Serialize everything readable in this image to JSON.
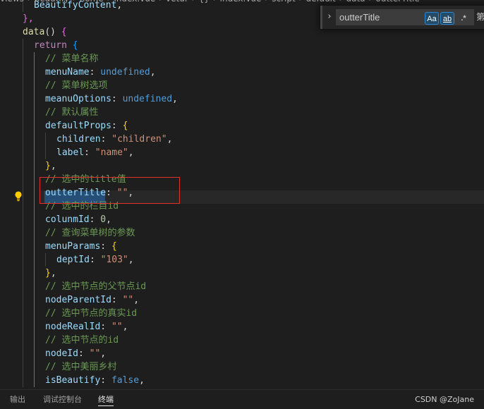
{
  "breadcrumb": {
    "items": [
      "views",
      "beautify",
      "home",
      "index.vue",
      "vetur",
      "{}",
      "index.vue",
      "script",
      "default",
      "data",
      "outterTitle"
    ]
  },
  "editor": {
    "lines": [
      [
        {
          "t": "BeautifyContent",
          "c": "prop"
        },
        {
          "t": ",",
          "c": "punc"
        }
      ],
      [
        {
          "t": "},",
          "c": "brace2"
        }
      ],
      [
        {
          "t": "data",
          "c": "func"
        },
        {
          "t": "() ",
          "c": "punc"
        },
        {
          "t": "{",
          "c": "brace2"
        }
      ],
      [
        {
          "t": "return",
          "c": "kw"
        },
        {
          "t": " ",
          "c": "punc"
        },
        {
          "t": "{",
          "c": "brace3"
        }
      ],
      [
        {
          "t": "// 菜单名称",
          "c": "comment"
        }
      ],
      [
        {
          "t": "menuName",
          "c": "prop"
        },
        {
          "t": ": ",
          "c": "punc"
        },
        {
          "t": "undefined",
          "c": "const"
        },
        {
          "t": ",",
          "c": "punc"
        }
      ],
      [
        {
          "t": "// 菜单树选项",
          "c": "comment"
        }
      ],
      [
        {
          "t": "meanuOptions",
          "c": "prop"
        },
        {
          "t": ": ",
          "c": "punc"
        },
        {
          "t": "undefined",
          "c": "const"
        },
        {
          "t": ",",
          "c": "punc"
        }
      ],
      [
        {
          "t": "// 默认属性",
          "c": "comment"
        }
      ],
      [
        {
          "t": "defaultProps",
          "c": "prop"
        },
        {
          "t": ": ",
          "c": "punc"
        },
        {
          "t": "{",
          "c": "brace1"
        }
      ],
      [
        {
          "t": "children",
          "c": "prop"
        },
        {
          "t": ": ",
          "c": "punc"
        },
        {
          "t": "\"children\"",
          "c": "str"
        },
        {
          "t": ",",
          "c": "punc"
        }
      ],
      [
        {
          "t": "label",
          "c": "prop"
        },
        {
          "t": ": ",
          "c": "punc"
        },
        {
          "t": "\"name\"",
          "c": "str"
        },
        {
          "t": ",",
          "c": "punc"
        }
      ],
      [
        {
          "t": "}",
          "c": "brace1"
        },
        {
          "t": ",",
          "c": "punc"
        }
      ],
      [
        {
          "t": "// 选中的title值",
          "c": "comment"
        }
      ],
      [
        {
          "t": "outterTitle",
          "c": "prop"
        },
        {
          "t": ": ",
          "c": "punc"
        },
        {
          "t": "\"\"",
          "c": "str"
        },
        {
          "t": ",",
          "c": "punc"
        }
      ],
      [
        {
          "t": "// 选中的栏目id",
          "c": "comment"
        }
      ],
      [
        {
          "t": "colunmId",
          "c": "prop"
        },
        {
          "t": ": ",
          "c": "punc"
        },
        {
          "t": "0",
          "c": "num"
        },
        {
          "t": ",",
          "c": "punc"
        }
      ],
      [
        {
          "t": "// 查询菜单树的参数",
          "c": "comment"
        }
      ],
      [
        {
          "t": "menuParams",
          "c": "prop"
        },
        {
          "t": ": ",
          "c": "punc"
        },
        {
          "t": "{",
          "c": "brace1"
        }
      ],
      [
        {
          "t": "deptId",
          "c": "prop"
        },
        {
          "t": ": ",
          "c": "punc"
        },
        {
          "t": "\"103\"",
          "c": "str"
        },
        {
          "t": ",",
          "c": "punc"
        }
      ],
      [
        {
          "t": "}",
          "c": "brace1"
        },
        {
          "t": ",",
          "c": "punc"
        }
      ],
      [
        {
          "t": "// 选中节点的父节点id",
          "c": "comment"
        }
      ],
      [
        {
          "t": "nodeParentId",
          "c": "prop"
        },
        {
          "t": ": ",
          "c": "punc"
        },
        {
          "t": "\"\"",
          "c": "str"
        },
        {
          "t": ",",
          "c": "punc"
        }
      ],
      [
        {
          "t": "// 选中节点的真实id",
          "c": "comment"
        }
      ],
      [
        {
          "t": "nodeRealId",
          "c": "prop"
        },
        {
          "t": ": ",
          "c": "punc"
        },
        {
          "t": "\"\"",
          "c": "str"
        },
        {
          "t": ",",
          "c": "punc"
        }
      ],
      [
        {
          "t": "// 选中节点的id",
          "c": "comment"
        }
      ],
      [
        {
          "t": "nodeId",
          "c": "prop"
        },
        {
          "t": ": ",
          "c": "punc"
        },
        {
          "t": "\"\"",
          "c": "str"
        },
        {
          "t": ",",
          "c": "punc"
        }
      ],
      [
        {
          "t": "// 选中美丽乡村",
          "c": "comment"
        }
      ],
      [
        {
          "t": "isBeautify",
          "c": "prop"
        },
        {
          "t": ": ",
          "c": "punc"
        },
        {
          "t": "false",
          "c": "const"
        },
        {
          "t": ",",
          "c": "punc"
        }
      ]
    ],
    "indent_levels": [
      2,
      1,
      1,
      2,
      3,
      3,
      3,
      3,
      3,
      3,
      4,
      4,
      3,
      3,
      3,
      3,
      3,
      3,
      3,
      4,
      3,
      3,
      3,
      3,
      3,
      3,
      3,
      3,
      3
    ]
  },
  "find_widget": {
    "query": "outterTitle",
    "match_case_label": "Aa",
    "whole_word_label": "ab",
    "regex_label": ".*",
    "result_label": "第"
  },
  "panel": {
    "tabs": [
      "输出",
      "调试控制台",
      "终端"
    ],
    "active_tab": "终端"
  },
  "watermark": "CSDN @ZoJane",
  "colors": {
    "background": "#1e1e1e",
    "comment": "#6a9955",
    "property": "#9cdcfe",
    "string": "#ce9178",
    "keyword": "#c586c0",
    "constant": "#569cd6",
    "highlight_box": "#e2302b",
    "selection": "#264f78"
  },
  "icons": {
    "lightbulb": "lightbulb-icon",
    "find_toggle": "chevron-right-icon"
  }
}
